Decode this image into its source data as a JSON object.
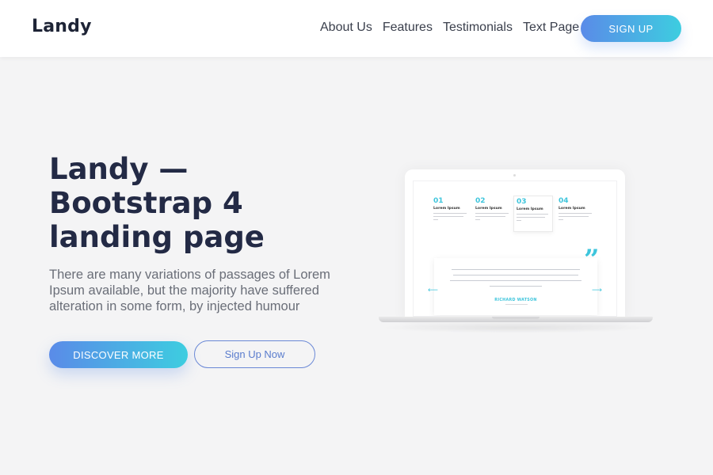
{
  "navbar": {
    "brand": "Landy",
    "links": [
      "About Us",
      "Features",
      "Testimonials",
      "Text Page"
    ],
    "signup_label": "SIGN UP"
  },
  "hero": {
    "title_lines": [
      "Landy —",
      "Bootstrap 4",
      "landing page"
    ],
    "description": "There are many variations of passages of Lorem Ipsum available, but the majority have suffered alteration in some form, by injected humour",
    "primary_button": "DISCOVER MORE",
    "secondary_button": "Sign Up Now"
  },
  "mockup": {
    "features": [
      {
        "number": "01",
        "title": "Lorem Ipsum"
      },
      {
        "number": "02",
        "title": "Lorem Ipsum"
      },
      {
        "number": "03",
        "title": "Lorem Ipsum"
      },
      {
        "number": "04",
        "title": "Lorem Ipsum"
      }
    ],
    "active_feature": 2,
    "testimonial_name": "RICHARD WATSON",
    "quote_glyph": "”",
    "arrow_left": "⟵",
    "arrow_right": "⟶"
  },
  "colors": {
    "accent_start": "#5a8be8",
    "accent_end": "#3dcde0",
    "heading": "#232a45",
    "background": "#f4f4f5"
  }
}
